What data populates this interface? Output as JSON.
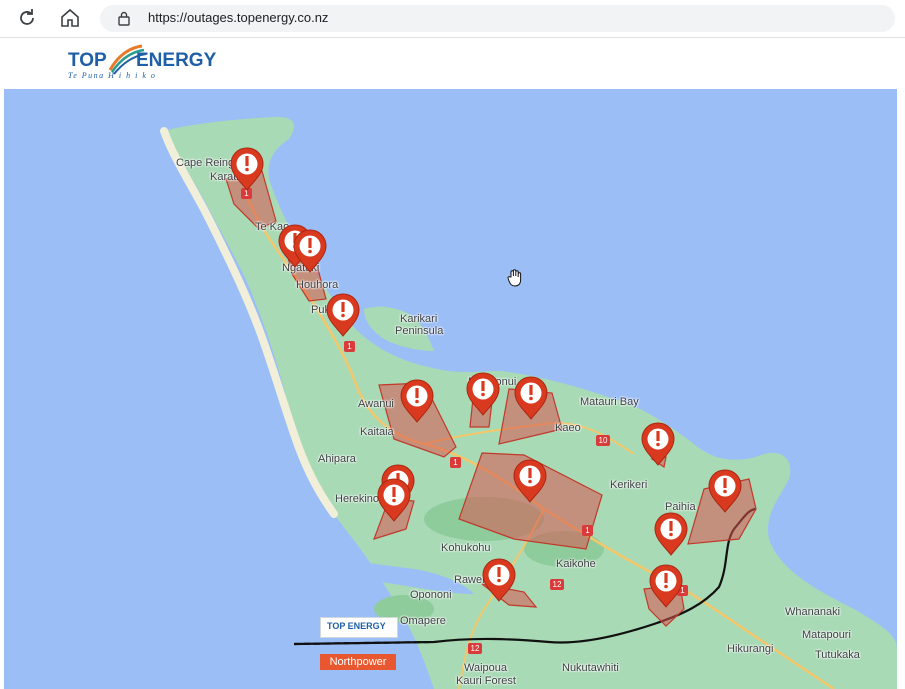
{
  "browser": {
    "url": "https://outages.topenergy.co.nz",
    "icons": [
      "reload-icon",
      "home-icon",
      "lock-icon"
    ]
  },
  "header": {
    "logo_text": "TOP ENERGY",
    "logo_tagline": "Te Puna Hihiko"
  },
  "map": {
    "labels": [
      "Cape Reinga",
      "Karatia",
      "Te Kao",
      "Ngataki",
      "Houhora",
      "Pukenui",
      "Karikari",
      "Peninsula",
      "Awanui",
      "Kaitaia",
      "Ahipara",
      "Herekino",
      "Kohukohu",
      "Rawene",
      "Opononi",
      "Omapere",
      "Waipoua",
      "Kauri Forest",
      "Mangonui",
      "Matauri Bay",
      "Kaeo",
      "Kerikeri",
      "Paihia",
      "Kaikohe",
      "Whananaki",
      "Matapouri",
      "Tutukaka",
      "Hikurangi",
      "Nukutawhiti"
    ],
    "road_numbers": [
      "1",
      "1",
      "1",
      "10",
      "1",
      "12",
      "12",
      "1"
    ],
    "outage_count": 16,
    "legend": {
      "top_energy": "TOP ENERGY",
      "northpower": "Northpower"
    },
    "colors": {
      "water": "#9bbef7",
      "land": "#a8dab5",
      "outage_fill": "#d9534f",
      "marker": "#d93a1f"
    }
  }
}
